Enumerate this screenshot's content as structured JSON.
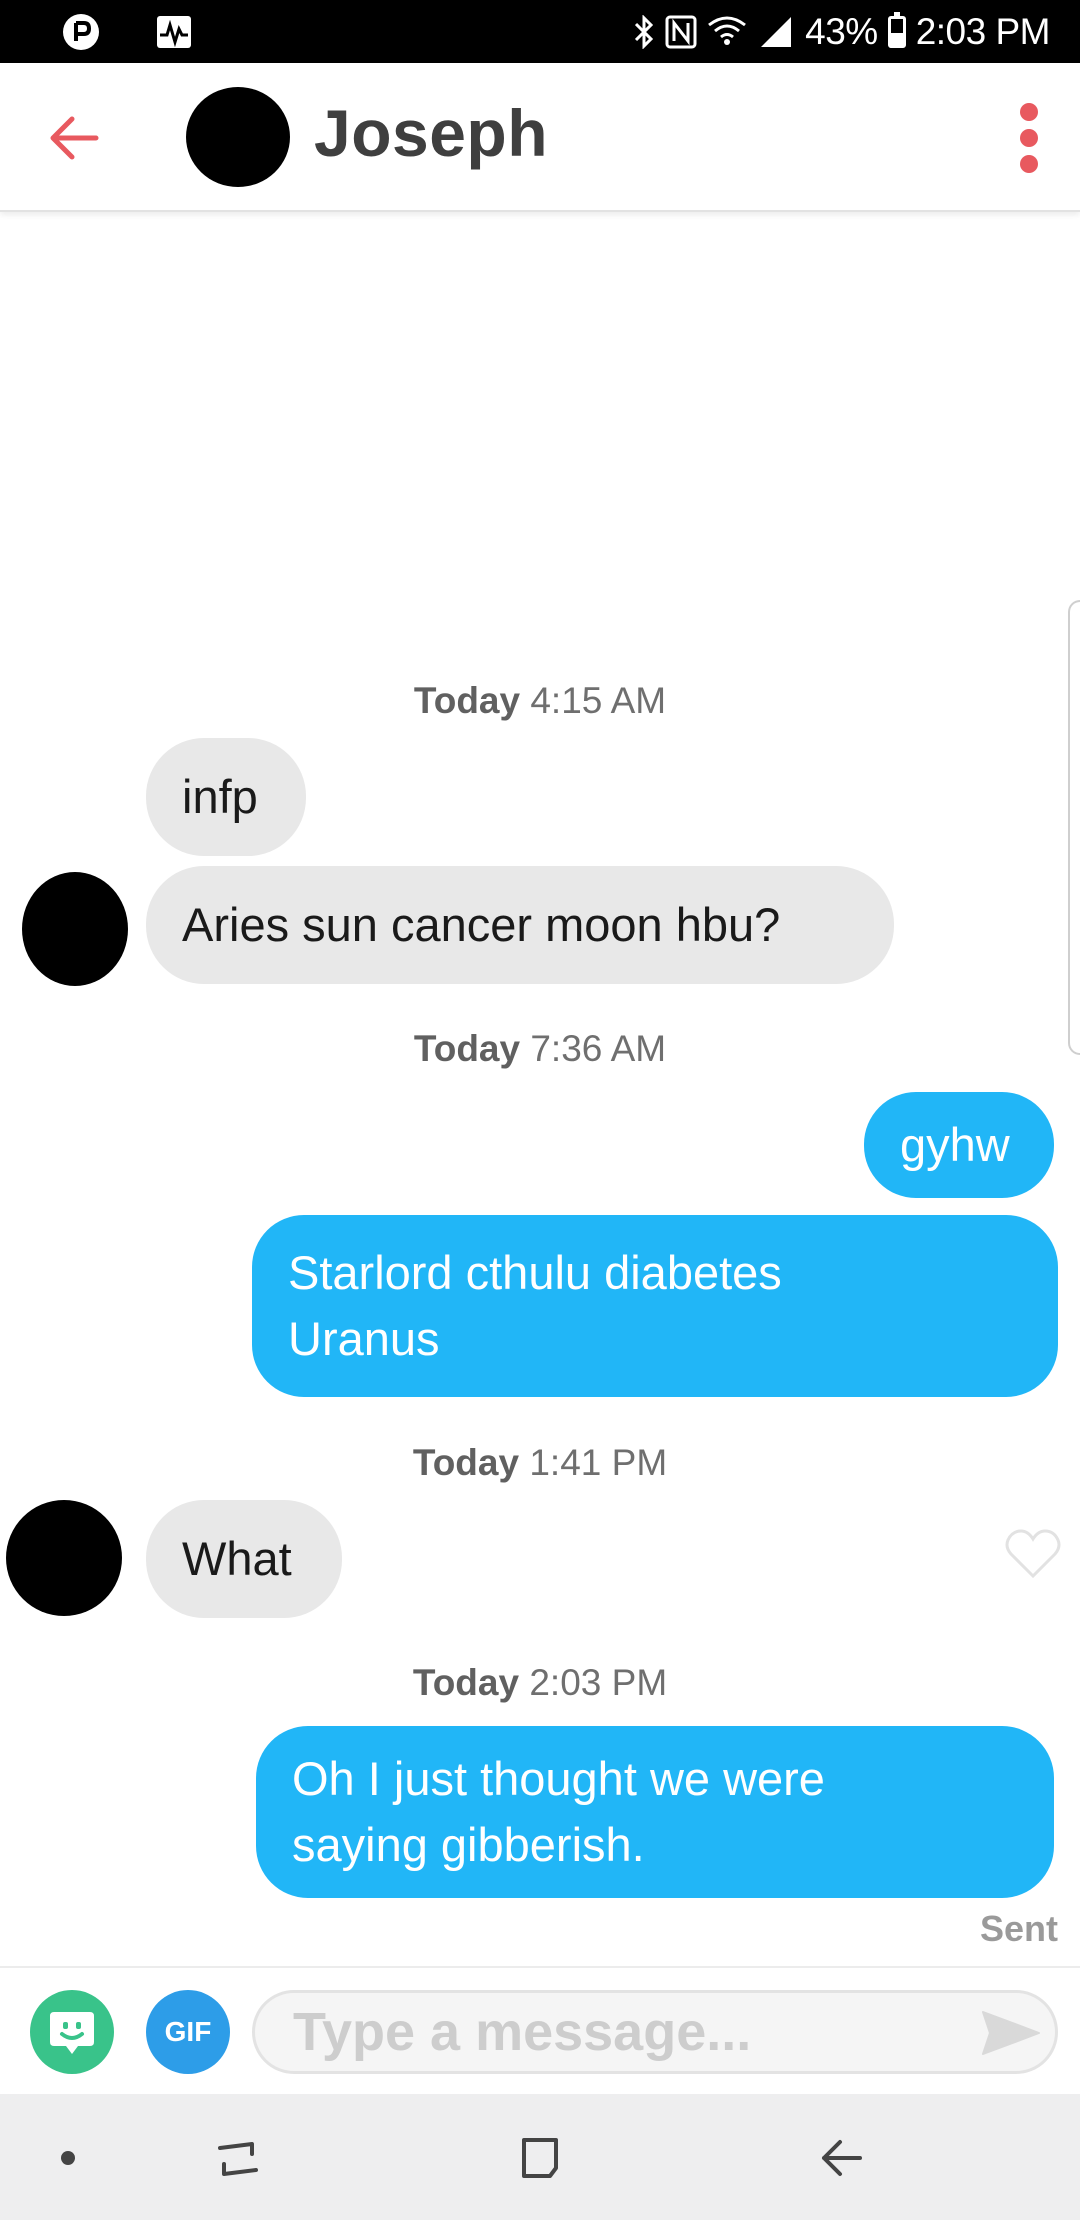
{
  "status_bar": {
    "battery": "43%",
    "time": "2:03 PM",
    "battery_level": 0.43,
    "app_icons": [
      "play-circle-icon",
      "pulse-monitor-icon"
    ],
    "system_icons": [
      "bluetooth-icon",
      "nfc-icon",
      "wifi-icon",
      "signal-icon",
      "battery-icon"
    ]
  },
  "header": {
    "contact_name": "Joseph",
    "back_icon": "arrow-left-icon",
    "menu_icon": "more-vertical-icon",
    "accent_color": "#e8595f"
  },
  "messages": {
    "ts1": {
      "day": "Today",
      "time": "4:15 AM"
    },
    "m1": {
      "text": "infp"
    },
    "m2": {
      "text": "Aries sun cancer moon hbu?"
    },
    "ts2": {
      "day": "Today",
      "time": "7:36 AM"
    },
    "m3": {
      "text": "gyhw"
    },
    "m4": {
      "line1": "Starlord cthulu diabetes",
      "line2": "Uranus"
    },
    "ts3": {
      "day": "Today",
      "time": "1:41 PM"
    },
    "m5": {
      "text": "What"
    },
    "ts4": {
      "day": "Today",
      "time": "2:03 PM"
    },
    "m6": {
      "line1": "Oh I just thought we were",
      "line2": "saying gibberish."
    },
    "status": "Sent"
  },
  "colors": {
    "incoming_bubble": "#e8e8e8",
    "outgoing_bubble": "#21b6f7",
    "sticker_button": "#39c38a",
    "gif_button": "#2d9de8"
  },
  "compose": {
    "gif_label": "GIF",
    "placeholder": "Type a message...",
    "value": ""
  },
  "nav_bar": {
    "items": [
      "dot-icon",
      "recent-apps-icon",
      "home-icon",
      "back-icon"
    ]
  }
}
